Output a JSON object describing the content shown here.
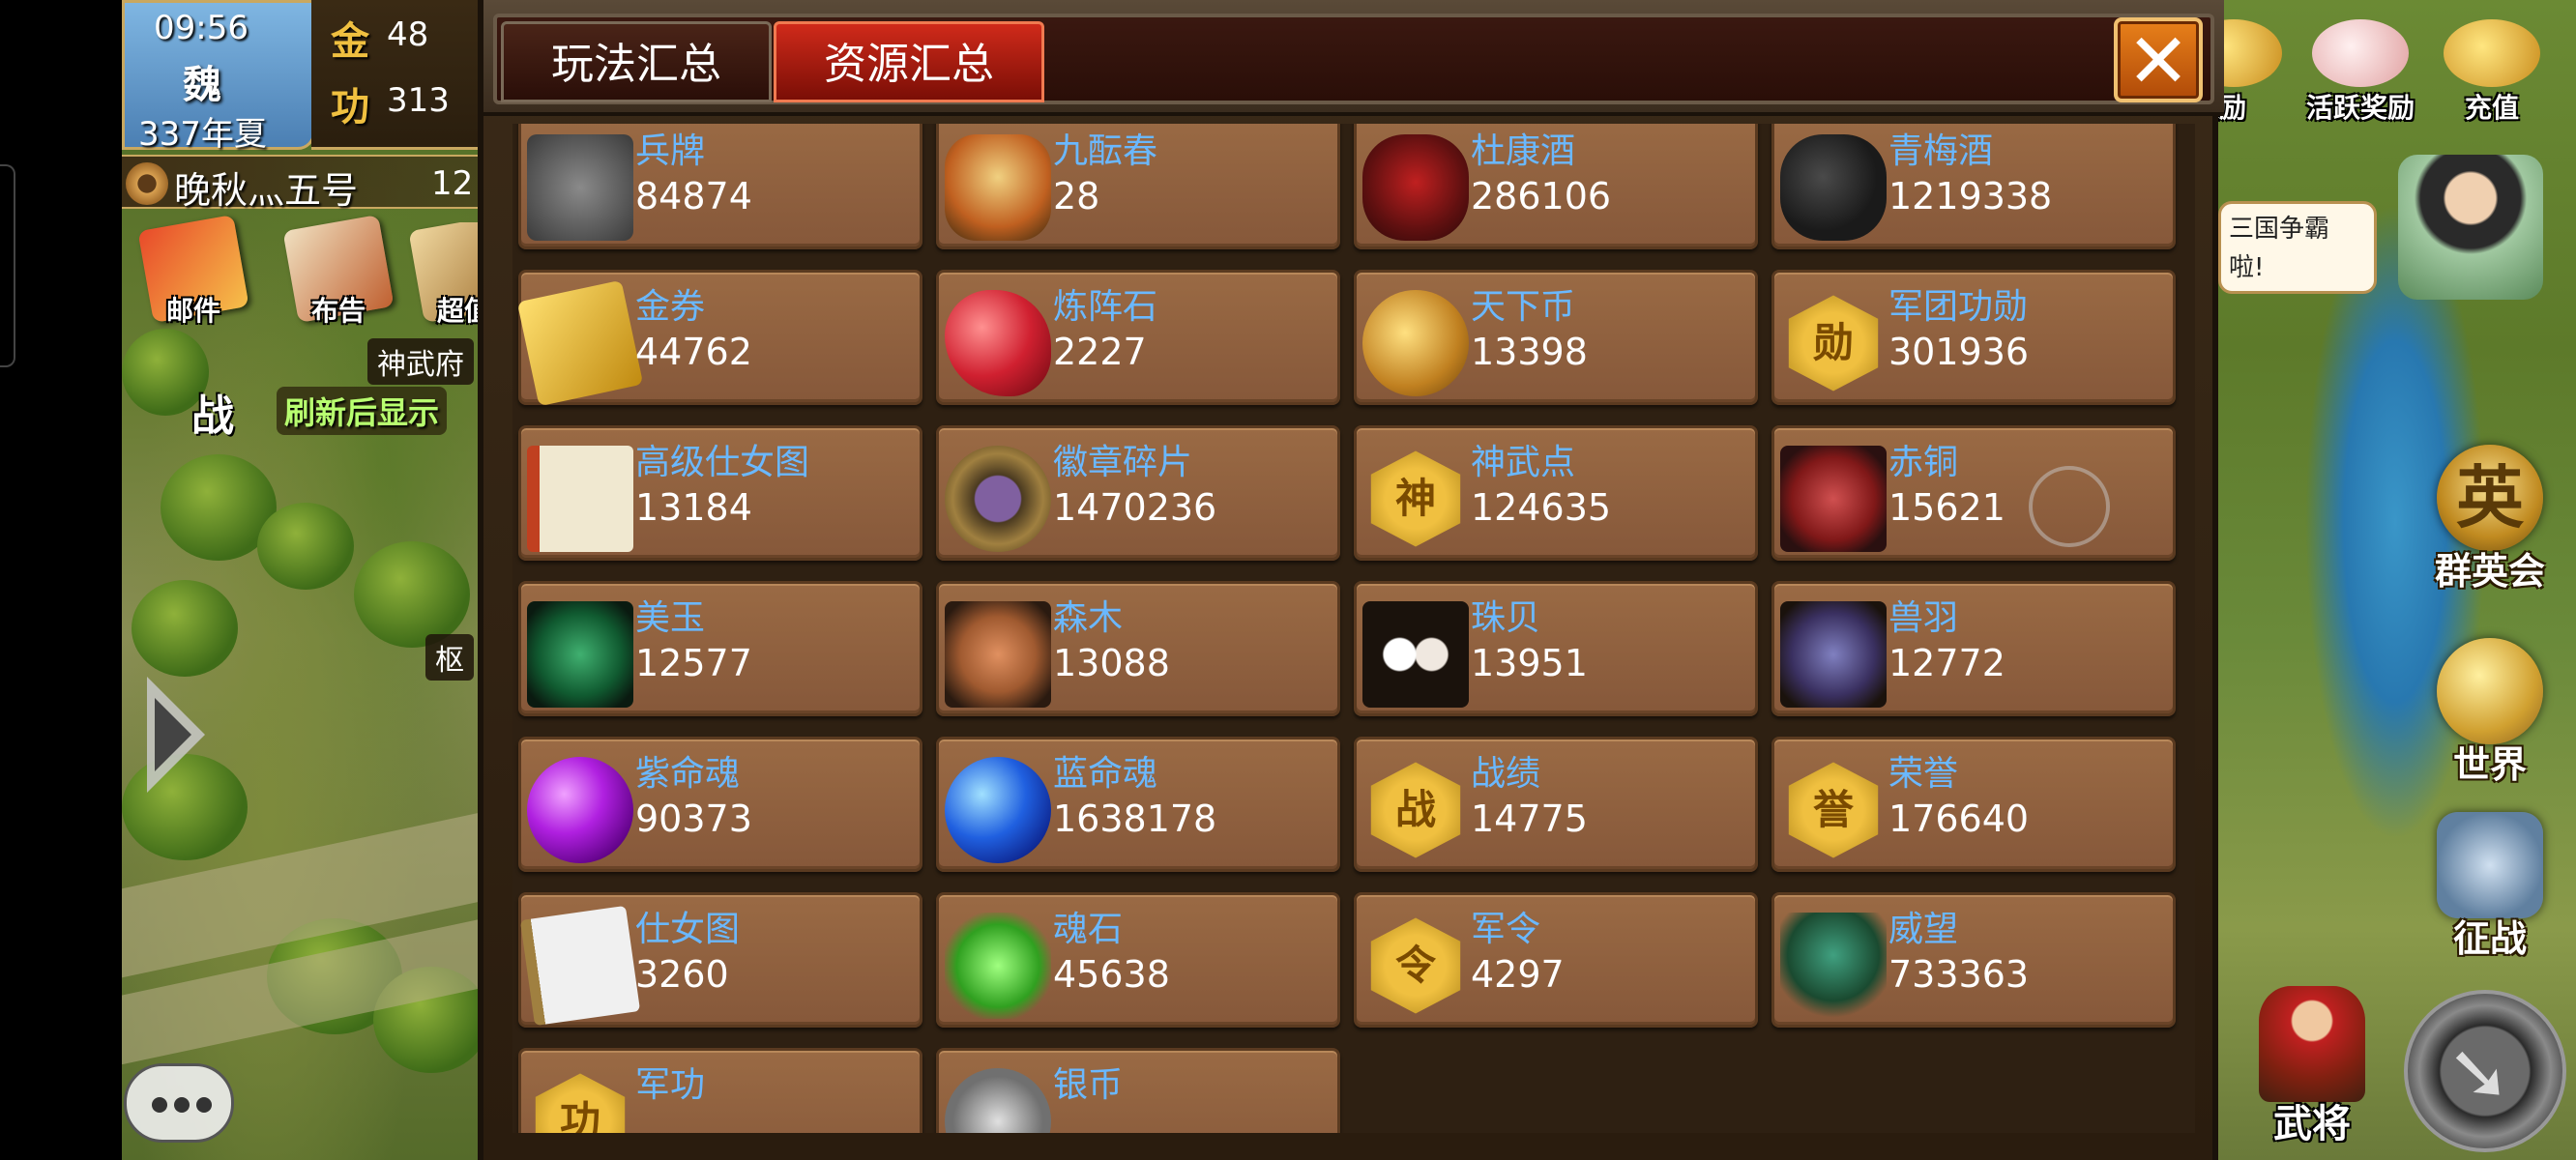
{
  "left_hud": {
    "time": "09:56",
    "kingdom": "魏",
    "year_season": "337年夏",
    "gold_label": "金",
    "gold_value": "48",
    "merit_label": "功",
    "merit_value": "313",
    "player_name": "晚秋灬五号",
    "player_num": "12",
    "menu": [
      {
        "label": "邮件"
      },
      {
        "label": "布告"
      },
      {
        "label": "超值"
      }
    ],
    "location_tag": "神武府",
    "location_tag2": "枢",
    "battle_icon": "战",
    "refresh_tip": "刷新后显示"
  },
  "right_hud": {
    "top_buttons": [
      {
        "label": "奖励"
      },
      {
        "label": "活跃奖励"
      },
      {
        "label": "充值"
      }
    ],
    "speech": "三国争霸\n啦!",
    "side_buttons": [
      {
        "label": "群英会",
        "glyph": "英"
      },
      {
        "label": "世界"
      },
      {
        "label": "征战"
      }
    ],
    "general_label": "武将"
  },
  "panel": {
    "tabs": [
      {
        "label": "玩法汇总",
        "active": false
      },
      {
        "label": "资源汇总",
        "active": true
      }
    ],
    "close_glyph": "✕",
    "resources": [
      {
        "name": "兵牌",
        "value": "84874",
        "icon": "token-icon"
      },
      {
        "name": "九酝春",
        "value": "28",
        "icon": "wine-jar-icon"
      },
      {
        "name": "杜康酒",
        "value": "286106",
        "icon": "wine-bottle-icon"
      },
      {
        "name": "青梅酒",
        "value": "1219338",
        "icon": "plum-wine-icon"
      },
      {
        "name": "金券",
        "value": "44762",
        "icon": "gold-ticket-icon"
      },
      {
        "name": "炼阵石",
        "value": "2227",
        "icon": "red-gem-icon"
      },
      {
        "name": "天下币",
        "value": "13398",
        "icon": "coin-icon"
      },
      {
        "name": "军团功勋",
        "value": "301936",
        "icon": "legion-merit-icon",
        "glyph": "勋"
      },
      {
        "name": "高级仕女图",
        "value": "13184",
        "icon": "scroll-icon"
      },
      {
        "name": "徽章碎片",
        "value": "1470236",
        "icon": "badge-shard-icon"
      },
      {
        "name": "神武点",
        "value": "124635",
        "icon": "shenwu-icon",
        "glyph": "神"
      },
      {
        "name": "赤铜",
        "value": "15621",
        "icon": "red-copper-icon"
      },
      {
        "name": "美玉",
        "value": "12577",
        "icon": "jade-icon"
      },
      {
        "name": "森木",
        "value": "13088",
        "icon": "wood-icon"
      },
      {
        "name": "珠贝",
        "value": "13951",
        "icon": "pearl-icon"
      },
      {
        "name": "兽羽",
        "value": "12772",
        "icon": "feather-icon"
      },
      {
        "name": "紫命魂",
        "value": "90373",
        "icon": "purple-soul-icon"
      },
      {
        "name": "蓝命魂",
        "value": "1638178",
        "icon": "blue-soul-icon"
      },
      {
        "name": "战绩",
        "value": "14775",
        "icon": "battle-record-icon",
        "glyph": "战"
      },
      {
        "name": "荣誉",
        "value": "176640",
        "icon": "honor-icon",
        "glyph": "誉"
      },
      {
        "name": "仕女图",
        "value": "3260",
        "icon": "painting-icon"
      },
      {
        "name": "魂石",
        "value": "45638",
        "icon": "soul-stone-icon"
      },
      {
        "name": "军令",
        "value": "4297",
        "icon": "military-order-icon",
        "glyph": "令"
      },
      {
        "name": "威望",
        "value": "733363",
        "icon": "prestige-icon"
      },
      {
        "name": "军功",
        "value": "",
        "icon": "military-merit-icon",
        "glyph": "功"
      },
      {
        "name": "银币",
        "value": "",
        "icon": "silver-coin-icon"
      }
    ]
  },
  "colors": {
    "resource_name": "#6ab8ff",
    "resource_value": "#ffffff",
    "card_bg": "#9a6a44",
    "tab_active": "#d02a1a",
    "close_button": "#e8801a"
  }
}
